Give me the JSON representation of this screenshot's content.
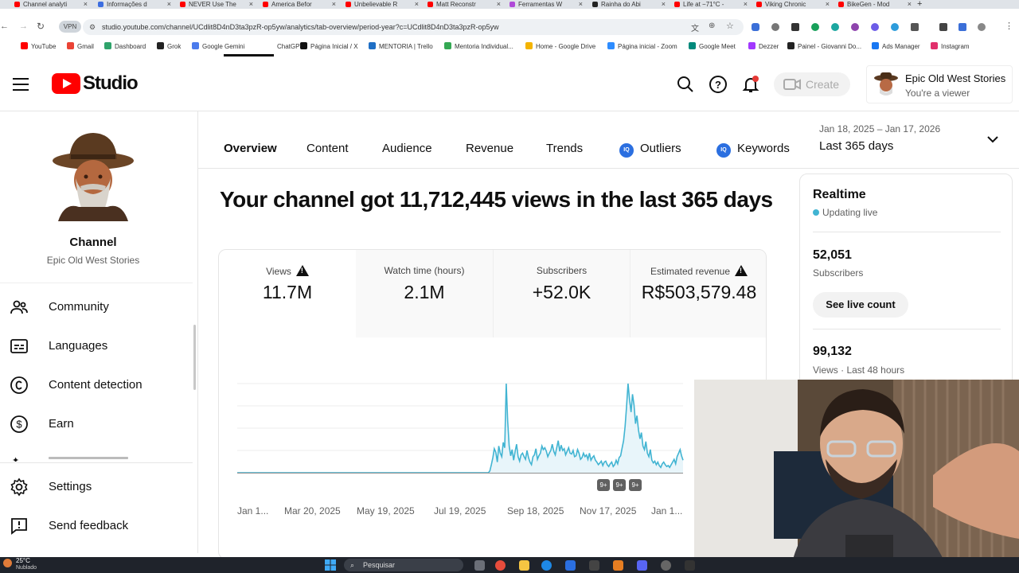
{
  "browser": {
    "tabs": [
      {
        "title": "Channel analyti",
        "color": "#ff0000"
      },
      {
        "title": "Informações d",
        "color": "#3d6ee0"
      },
      {
        "title": "NEVER Use The",
        "color": "#ff0000"
      },
      {
        "title": "America Befor",
        "color": "#ff0000"
      },
      {
        "title": "Unbelievable R",
        "color": "#ff0000"
      },
      {
        "title": "Matt Reconstr",
        "color": "#ff0000"
      },
      {
        "title": "Ferramentas W",
        "color": "#b04ad8"
      },
      {
        "title": "Rainha do Abi",
        "color": "#222222"
      },
      {
        "title": "Life at −71°C -",
        "color": "#ff0000"
      },
      {
        "title": "Viking Chronic",
        "color": "#ff0000"
      },
      {
        "title": "BikeGen - Mod",
        "color": "#ff0000"
      }
    ],
    "vpn_label": "VPN",
    "url": "studio.youtube.com/channel/UCdlit8D4nD3ta3pzR-op5yw/analytics/tab-overview/period-year?c=UCdlit8D4nD3ta3pzR-op5yw",
    "bookmarks": [
      {
        "label": "YouTube",
        "color": "#ff0000"
      },
      {
        "label": "Gmail",
        "color": "#ea4335"
      },
      {
        "label": "Dashboard",
        "color": "#2fa36b"
      },
      {
        "label": "Grok",
        "color": "#222222"
      },
      {
        "label": "Google Gemini",
        "color": "#4b7bec"
      },
      {
        "label": "ChatGPT",
        "color": "#ffffff"
      },
      {
        "label": "Página Inicial / X",
        "color": "#111111"
      },
      {
        "label": "MENTORIA | Trello",
        "color": "#1f6fc5"
      },
      {
        "label": "Mentoria Individual...",
        "color": "#34a853"
      },
      {
        "label": "Home - Google Drive",
        "color": "#f4b400"
      },
      {
        "label": "Página inicial - Zoom",
        "color": "#2d8cff"
      },
      {
        "label": "Google Meet",
        "color": "#00897b"
      },
      {
        "label": "Dezzer",
        "color": "#a238ff"
      },
      {
        "label": "Painel - Giovanni Do...",
        "color": "#222222"
      },
      {
        "label": "Ads Manager",
        "color": "#1877f2"
      },
      {
        "label": "Instagram",
        "color": "#e1306c"
      }
    ]
  },
  "header": {
    "logo_text": "Studio",
    "create_label": "Create",
    "account_name": "Epic Old West Stories",
    "account_role": "You're a viewer"
  },
  "sidebar": {
    "channel_label": "Channel",
    "channel_name": "Epic Old West Stories",
    "items": [
      {
        "label": "Community",
        "icon": "community-icon"
      },
      {
        "label": "Languages",
        "icon": "subtitles-icon"
      },
      {
        "label": "Content detection",
        "icon": "copyright-icon"
      },
      {
        "label": "Earn",
        "icon": "dollar-icon"
      },
      {
        "label": "Settings",
        "icon": "gear-icon"
      },
      {
        "label": "Send feedback",
        "icon": "feedback-icon"
      }
    ]
  },
  "analytics": {
    "tabs": [
      "Overview",
      "Content",
      "Audience",
      "Revenue",
      "Trends",
      "Outliers",
      "Keywords"
    ],
    "active_tab": "Overview",
    "iq_badge": "IQ",
    "date_range": "Jan 18, 2025 – Jan 17, 2026",
    "period_label": "Last 365 days",
    "headline": "Your channel got 11,712,445 views in the last 365 days",
    "metrics": [
      {
        "label": "Views",
        "value": "11.7M",
        "warning": true
      },
      {
        "label": "Watch time (hours)",
        "value": "2.1M",
        "warning": false
      },
      {
        "label": "Subscribers",
        "value": "+52.0K",
        "warning": false
      },
      {
        "label": "Estimated revenue",
        "value": "R$503,579.48",
        "warning": true
      }
    ],
    "badges": [
      "9+",
      "9+",
      "9+"
    ]
  },
  "chart_data": {
    "type": "area",
    "title": "",
    "xlabel": "",
    "ylabel": "",
    "x_tick_labels": [
      "Jan 1...",
      "Mar 20, 2025",
      "May 19, 2025",
      "Jul 19, 2025",
      "Sep 18, 2025",
      "Nov 17, 2025",
      "Jan 1..."
    ],
    "y_tick_labels_visible": false,
    "series": [
      {
        "values": [
          0,
          0,
          0,
          0,
          0,
          0,
          0,
          0,
          0,
          0,
          0,
          0,
          0,
          0,
          0,
          0,
          0,
          0,
          0,
          0,
          0,
          0,
          0,
          0,
          0,
          0,
          0,
          0,
          0,
          0,
          0,
          0,
          0,
          0,
          0,
          0,
          0,
          0,
          0,
          0,
          0,
          0,
          0,
          0,
          0,
          0,
          0,
          0,
          0,
          0,
          0,
          0,
          0,
          0,
          0,
          0,
          0,
          0,
          0,
          0,
          0,
          0,
          0,
          0,
          0,
          0,
          0,
          0,
          0,
          0,
          0,
          0,
          0,
          0,
          0,
          0,
          0,
          0,
          0,
          0,
          0,
          0,
          0,
          0,
          0,
          0,
          0,
          0,
          0,
          0,
          0,
          0,
          0,
          0,
          0,
          0,
          0,
          0,
          0,
          0,
          0,
          0,
          0,
          0,
          0,
          0,
          0,
          0,
          0,
          0,
          0,
          0,
          0,
          0,
          0,
          0,
          0,
          0,
          0,
          0,
          0,
          0,
          0,
          0,
          0,
          0,
          0,
          0,
          0,
          0,
          0,
          0,
          0,
          0,
          0,
          0,
          0,
          0,
          0,
          0,
          0,
          0,
          0,
          0,
          0,
          0,
          0,
          0,
          0,
          0,
          0,
          0,
          0,
          0,
          0,
          0,
          0,
          0,
          0,
          0,
          0,
          0,
          0,
          0,
          0,
          0,
          0,
          0,
          0,
          0,
          2,
          9,
          17,
          27,
          23,
          12,
          30,
          22,
          18,
          34,
          28,
          100,
          58,
          30,
          19,
          26,
          14,
          24,
          32,
          18,
          13,
          20,
          22,
          18,
          15,
          25,
          17,
          12,
          9,
          18,
          20,
          27,
          15,
          19,
          22,
          30,
          26,
          28,
          24,
          18,
          22,
          25,
          32,
          24,
          20,
          28,
          36,
          24,
          31,
          25,
          27,
          20,
          24,
          28,
          22,
          21,
          25,
          18,
          19,
          26,
          22,
          15,
          17,
          22,
          18,
          20,
          15,
          22,
          14,
          17,
          19,
          14,
          12,
          9,
          11,
          13,
          8,
          12,
          13,
          9,
          7,
          10,
          12,
          7,
          9,
          14,
          10,
          17,
          19,
          28,
          36,
          52,
          75,
          100,
          82,
          68,
          88,
          76,
          55,
          64,
          48,
          38,
          45,
          30,
          26,
          35,
          22,
          18,
          26,
          14,
          11,
          13,
          9,
          12,
          8,
          6,
          10,
          12,
          9,
          7,
          8,
          6,
          9,
          12,
          15,
          10,
          18,
          22,
          26,
          19,
          14
        ]
      }
    ]
  },
  "realtime": {
    "title": "Realtime",
    "status": "Updating live",
    "subs_value": "52,051",
    "subs_caption": "Subscribers",
    "button_label": "See live count",
    "views_value": "99,132",
    "views_caption": "Views · Last 48 hours"
  },
  "taskbar": {
    "weather_temp": "25°C",
    "weather_desc": "Nublado",
    "search_placeholder": "Pesquisar"
  }
}
